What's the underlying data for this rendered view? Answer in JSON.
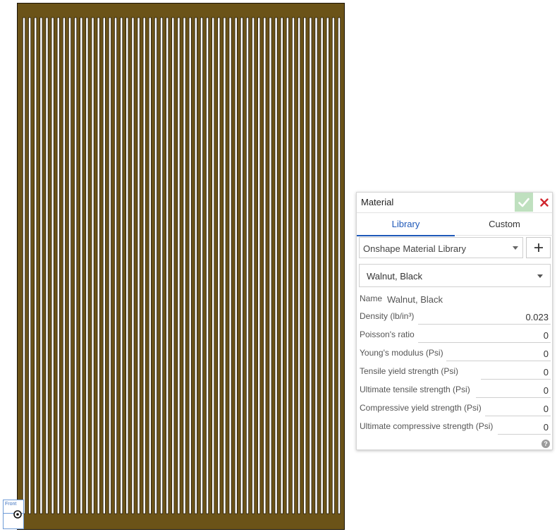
{
  "viewport": {
    "part_color": "#6b5318",
    "slot_count": 56,
    "view_cube_label": "Front"
  },
  "material_dialog": {
    "title": "Material",
    "accept_icon": "checkmark-icon",
    "cancel_icon": "close-icon",
    "tabs": [
      {
        "label": "Library",
        "active": true
      },
      {
        "label": "Custom",
        "active": false
      }
    ],
    "library_select": "Onshape Material Library",
    "add_icon": "plus-icon",
    "material_select": "Walnut, Black",
    "name_label": "Name",
    "name_value": "Walnut, Black",
    "properties": [
      {
        "label": "Density (lb/in³)",
        "value": "0.023"
      },
      {
        "label": "Poisson's ratio",
        "value": "0"
      },
      {
        "label": "Young's modulus (Psi)",
        "value": "0"
      },
      {
        "label": "Tensile yield strength (Psi)",
        "value": "0"
      },
      {
        "label": "Ultimate tensile strength (Psi)",
        "value": "0"
      },
      {
        "label": "Compressive yield strength (Psi)",
        "value": "0"
      },
      {
        "label": "Ultimate compressive strength (Psi)",
        "value": "0"
      }
    ],
    "help_icon": "help-icon",
    "accent_color": "#1e58b8"
  }
}
